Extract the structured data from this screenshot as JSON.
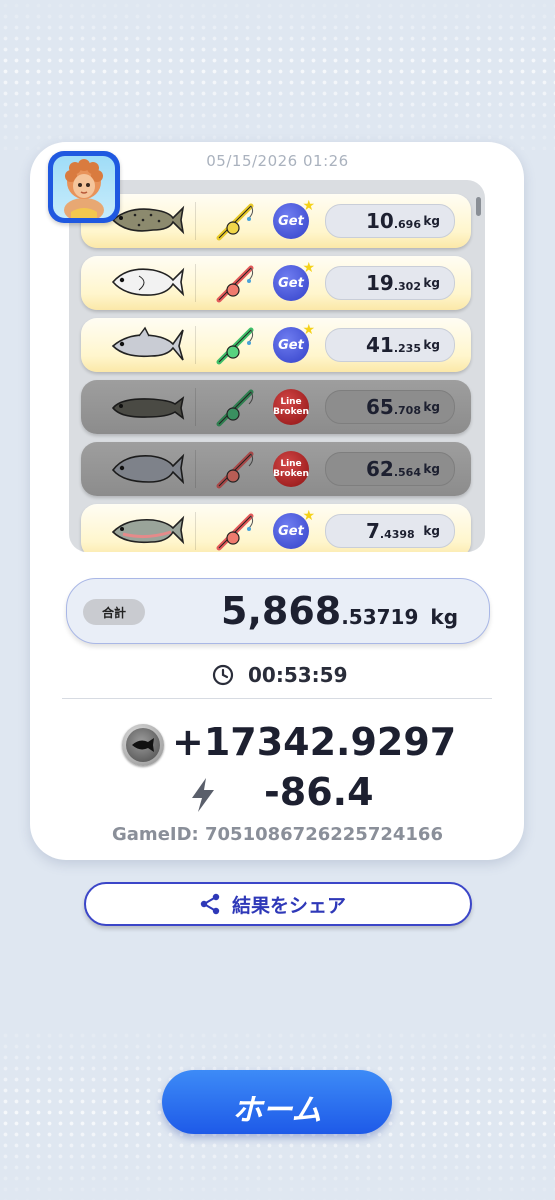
{
  "header": {
    "datetime": "05/15/2026 01:26"
  },
  "avatar": {
    "name": "player-avatar"
  },
  "catches": [
    {
      "fish_icon": "trout-fish-icon",
      "rod_icon": "yellow-rod-icon",
      "result": "Get",
      "weight_int": "10",
      "weight_dec": ".696",
      "unit": "kg"
    },
    {
      "fish_icon": "white-fish-icon",
      "rod_icon": "red-rod-icon",
      "result": "Get",
      "weight_int": "19",
      "weight_dec": ".302",
      "unit": "kg"
    },
    {
      "fish_icon": "catfish-icon",
      "rod_icon": "green-rod-icon",
      "result": "Get",
      "weight_int": "41",
      "weight_dec": ".235",
      "unit": "kg"
    },
    {
      "fish_icon": "snakehead-fish-icon",
      "rod_icon": "green-rod-icon",
      "result_line1": "Line",
      "result_line2": "Broken",
      "weight_int": "65",
      "weight_dec": ".708",
      "unit": "kg"
    },
    {
      "fish_icon": "bass-fish-icon",
      "rod_icon": "red-rod-icon",
      "result_line1": "Line",
      "result_line2": "Broken",
      "weight_int": "62",
      "weight_dec": ".564",
      "unit": "kg"
    },
    {
      "fish_icon": "salmon-fish-icon",
      "rod_icon": "red-rod-icon",
      "result": "Get",
      "weight_int": "7",
      "weight_dec": ".4398",
      "unit": "kg"
    }
  ],
  "total": {
    "label": "合計",
    "int": "5,868",
    "dec": ".53719",
    "unit": "kg"
  },
  "elapsed": {
    "icon": "clock-icon",
    "time": "00:53:59"
  },
  "reward": {
    "icon": "coin-icon",
    "value": "+17342.9297"
  },
  "energy": {
    "icon": "lightning-icon",
    "value": "-86.4"
  },
  "game_id": "GameID: 7051086726225724166",
  "share_button": {
    "icon": "share-icon",
    "label": "結果をシェア"
  },
  "home_button": {
    "label": "ホーム"
  },
  "colors": {
    "accent": "#1e5ae8",
    "badge_get": "#3341c9",
    "badge_broken": "#8e1313",
    "row_gold": "#fff6cd"
  }
}
